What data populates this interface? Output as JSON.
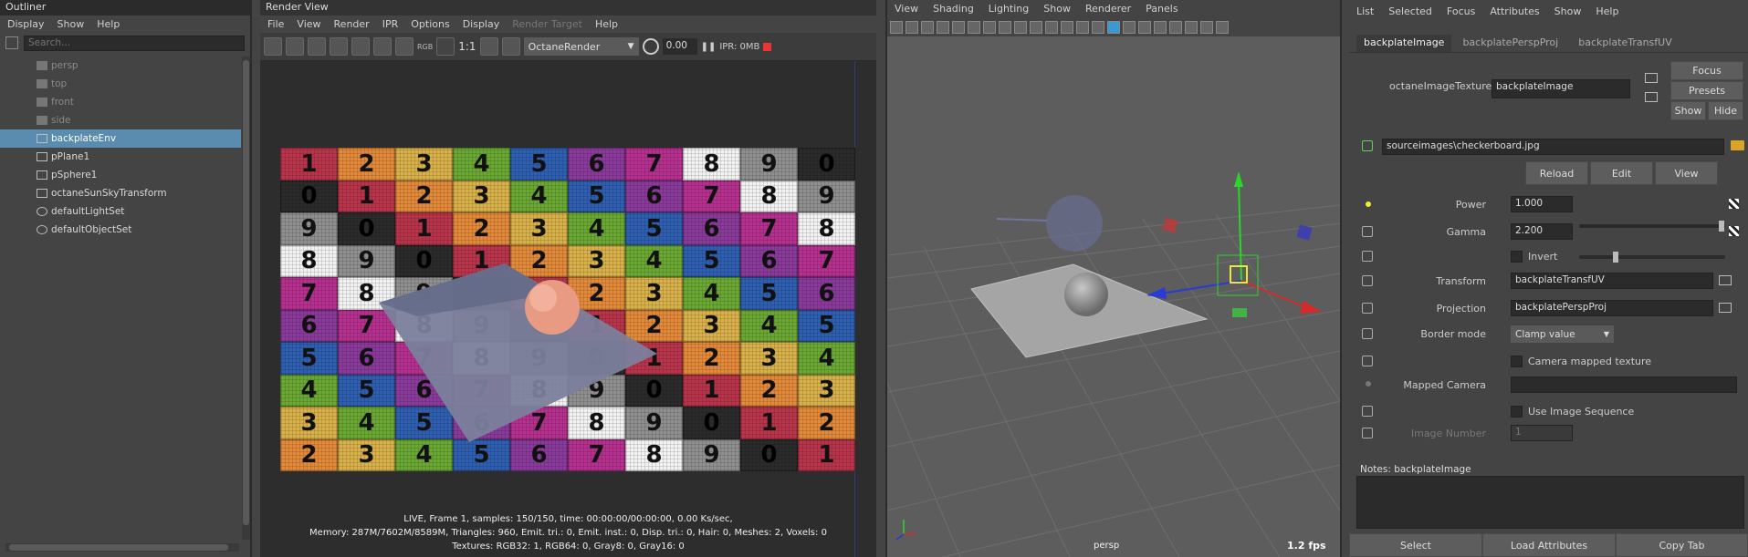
{
  "outliner": {
    "title": "Outliner",
    "menu": [
      "Display",
      "Show",
      "Help"
    ],
    "search_placeholder": "Search...",
    "items": [
      {
        "label": "persp",
        "icon": "camera-icon",
        "dim": true
      },
      {
        "label": "top",
        "icon": "camera-icon",
        "dim": true
      },
      {
        "label": "front",
        "icon": "camera-icon",
        "dim": true
      },
      {
        "label": "side",
        "icon": "camera-icon",
        "dim": true
      },
      {
        "label": "backplateEnv",
        "icon": "environment-icon",
        "selected": true
      },
      {
        "label": "pPlane1",
        "icon": "mesh-icon"
      },
      {
        "label": "pSphere1",
        "icon": "mesh-icon"
      },
      {
        "label": "octaneSunSkyTransform",
        "icon": "transform-icon"
      },
      {
        "label": "defaultLightSet",
        "icon": "set-icon"
      },
      {
        "label": "defaultObjectSet",
        "icon": "set-icon"
      }
    ]
  },
  "render_view": {
    "title": "Render View",
    "menu": [
      "File",
      "View",
      "Render",
      "IPR",
      "Options",
      "Display",
      "Render Target",
      "Help"
    ],
    "renderer": "OctaneRender",
    "exposure": "0.00",
    "ratio": "1:1",
    "rgb": "RGB",
    "ipr_label": "IPR: 0MB",
    "checker": [
      [
        "1",
        "2",
        "3",
        "4",
        "5",
        "6",
        "7",
        "8",
        "9",
        "0"
      ],
      [
        "0",
        "1",
        "2",
        "3",
        "4",
        "5",
        "6",
        "7",
        "8",
        "9"
      ],
      [
        "9",
        "0",
        "1",
        "2",
        "3",
        "4",
        "5",
        "6",
        "7",
        "8"
      ],
      [
        "8",
        "9",
        "0",
        "1",
        "2",
        "3",
        "4",
        "5",
        "6",
        "7"
      ],
      [
        "7",
        "8",
        "9",
        "0",
        "1",
        "2",
        "3",
        "4",
        "5",
        "6"
      ],
      [
        "6",
        "7",
        "8",
        "9",
        "0",
        "1",
        "2",
        "3",
        "4",
        "5"
      ],
      [
        "5",
        "6",
        "7",
        "8",
        "9",
        "0",
        "1",
        "2",
        "3",
        "4"
      ],
      [
        "4",
        "5",
        "6",
        "7",
        "8",
        "9",
        "0",
        "1",
        "2",
        "3"
      ],
      [
        "3",
        "4",
        "5",
        "6",
        "7",
        "8",
        "9",
        "0",
        "1",
        "2"
      ],
      [
        "2",
        "3",
        "4",
        "5",
        "6",
        "7",
        "8",
        "9",
        "0",
        "1"
      ]
    ],
    "colors": [
      "#b8344a",
      "#e38a3a",
      "#d8b14a",
      "#6aa833",
      "#2f5fb0",
      "#8a3a9a",
      "#b5308f",
      "#f2f2f2",
      "#8f8f8f",
      "#2b2b2b"
    ],
    "status_lines": [
      "LIVE, Frame 1, samples: 150/150, time: 00:00:00/00:00:00, 0.00 Ks/sec,",
      "Memory: 287M/7602M/8589M, Triangles: 960, Emit. tri.: 0, Emit. inst.: 0, Disp. tri.: 0, Hair: 0, Meshes: 2, Voxels: 0",
      "Textures: RGB32: 1, RGB64: 0, Gray8: 0, Gray16: 0"
    ]
  },
  "viewport": {
    "menu": [
      "View",
      "Shading",
      "Lighting",
      "Show",
      "Renderer",
      "Panels"
    ],
    "camera_label": "persp",
    "fps": "1.2 fps"
  },
  "attr": {
    "menu": [
      "List",
      "Selected",
      "Focus",
      "Attributes",
      "Show",
      "Help"
    ],
    "tabs": [
      "backplateImage",
      "backplatePerspProj",
      "backplateTransfUV"
    ],
    "node_type_label": "octaneImageTexture:",
    "node_name": "backplateImage",
    "focus": "Focus",
    "presets": "Presets",
    "show": "Show",
    "hide": "Hide",
    "file_path": "sourceimages\\checkerboard.jpg",
    "reload": "Reload",
    "edit": "Edit",
    "view": "View",
    "power_label": "Power",
    "power": "1.000",
    "gamma_label": "Gamma",
    "gamma": "2.200",
    "invert": "Invert",
    "transform_label": "Transform",
    "transform": "backplateTransfUV",
    "projection_label": "Projection",
    "projection": "backplatePerspProj",
    "border_label": "Border mode",
    "border": "Clamp value",
    "camera_mapped": "Camera mapped texture",
    "mapped_camera_label": "Mapped Camera",
    "use_seq": "Use Image Sequence",
    "image_number_label": "Image Number",
    "image_number": "1",
    "notes": "Notes:  backplateImage",
    "select": "Select",
    "load_attrs": "Load Attributes",
    "copy_tab": "Copy Tab"
  }
}
